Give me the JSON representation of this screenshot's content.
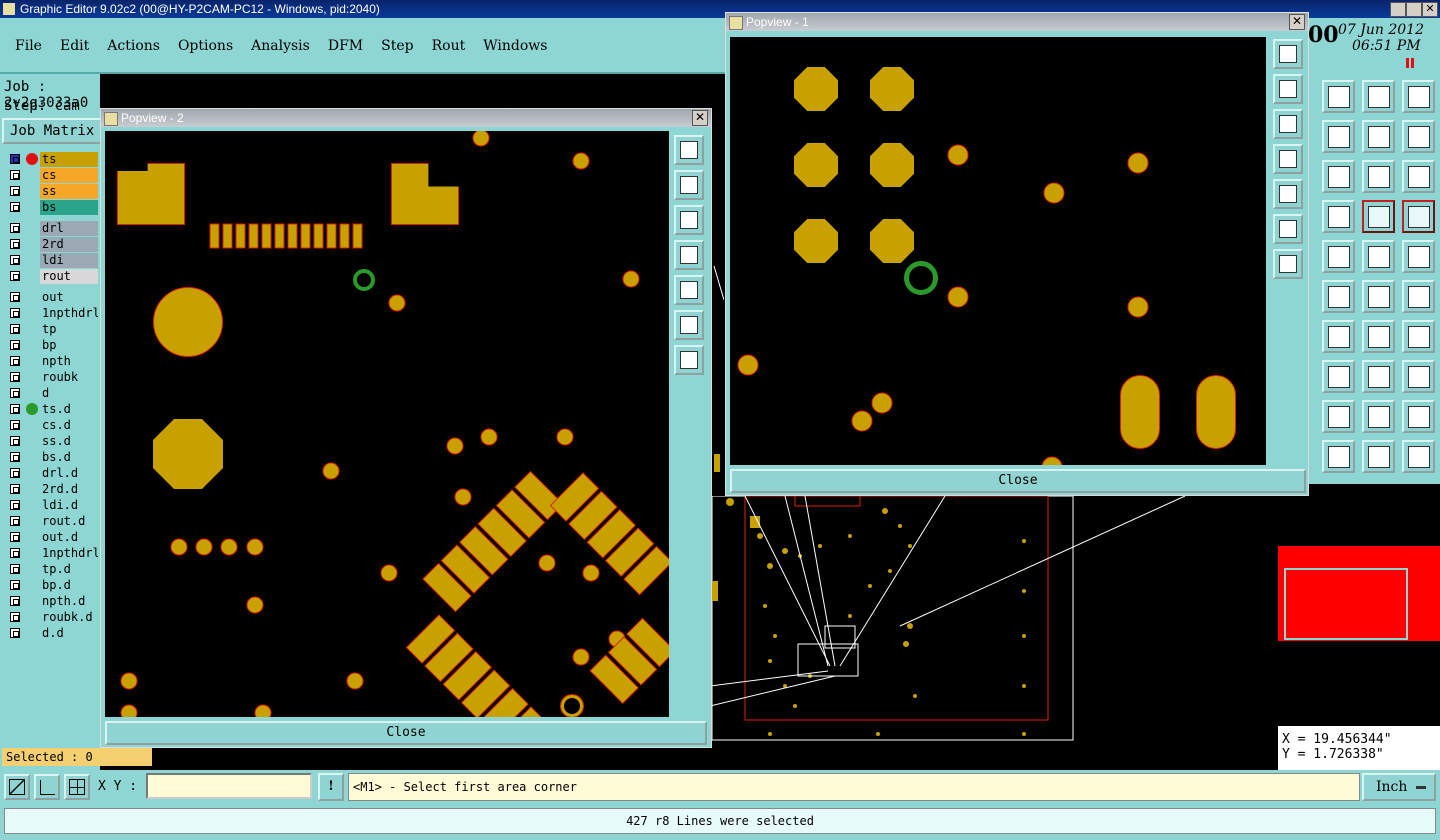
{
  "app": {
    "title": "Graphic Editor 9.02c2 (00@HY-P2CAM-PC12 - Windows, pid:2040)"
  },
  "menu": [
    "File",
    "Edit",
    "Actions",
    "Options",
    "Analysis",
    "DFM",
    "Step",
    "Rout",
    "Windows"
  ],
  "job": {
    "job_label": "Job : 2v2q3033a0",
    "step_label": "Step: cam",
    "matrix_button": "Job Matrix"
  },
  "layers": [
    {
      "name": "ts",
      "color": "#c8a000",
      "dot": "#e01010",
      "selected": true
    },
    {
      "name": "cs",
      "color": "#f5a828"
    },
    {
      "name": "ss",
      "color": "#f5a828"
    },
    {
      "name": "bs",
      "color": "#2aa58a"
    },
    {
      "name": "drl",
      "color": "#9aa9b4"
    },
    {
      "name": "2rd",
      "color": "#9aa9b4"
    },
    {
      "name": "ldi",
      "color": "#9aa9b4"
    },
    {
      "name": "rout",
      "color": "#d8d8d8"
    },
    {
      "name": "out",
      "color": "#8ed6d4"
    },
    {
      "name": "1npthdrl",
      "color": "#8ed6d4"
    },
    {
      "name": "tp",
      "color": "#8ed6d4"
    },
    {
      "name": "bp",
      "color": "#8ed6d4"
    },
    {
      "name": "npth",
      "color": "#8ed6d4"
    },
    {
      "name": "roubk",
      "color": "#8ed6d4"
    },
    {
      "name": "d",
      "color": "#8ed6d4"
    },
    {
      "name": "ts.d",
      "color": "#8ed6d4",
      "dot": "#2a9a2a"
    },
    {
      "name": "cs.d",
      "color": "#8ed6d4"
    },
    {
      "name": "ss.d",
      "color": "#8ed6d4"
    },
    {
      "name": "bs.d",
      "color": "#8ed6d4"
    },
    {
      "name": "drl.d",
      "color": "#8ed6d4"
    },
    {
      "name": "2rd.d",
      "color": "#8ed6d4"
    },
    {
      "name": "ldi.d",
      "color": "#8ed6d4"
    },
    {
      "name": "rout.d",
      "color": "#8ed6d4"
    },
    {
      "name": "out.d",
      "color": "#8ed6d4"
    },
    {
      "name": "1npthdrl",
      "color": "#8ed6d4"
    },
    {
      "name": "tp.d",
      "color": "#8ed6d4"
    },
    {
      "name": "bp.d",
      "color": "#8ed6d4"
    },
    {
      "name": "npth.d",
      "color": "#8ed6d4"
    },
    {
      "name": "roubk.d",
      "color": "#8ed6d4"
    },
    {
      "name": "d.d",
      "color": "#8ed6d4"
    }
  ],
  "status": {
    "selected": "Selected : 0",
    "xy_label": "X Y :",
    "xy_value": "",
    "prompt": "<M1> - Select first area corner",
    "units": "Inch",
    "message": "427 r8 Lines were selected"
  },
  "coords": {
    "x": "X = 19.456344\"",
    "y": "Y = 1.726338\""
  },
  "clock": {
    "date": "07 Jun 2012",
    "time": "06:51 PM",
    "prefix": "00"
  },
  "popview1": {
    "title": "Popview - 1",
    "close": "Close"
  },
  "popview2": {
    "title": "Popview - 2",
    "close": "Close"
  },
  "colors": {
    "pad": "#c8a000",
    "pad_outline": "#e02000",
    "teal": "#8ed6d4",
    "background": "#000000"
  }
}
